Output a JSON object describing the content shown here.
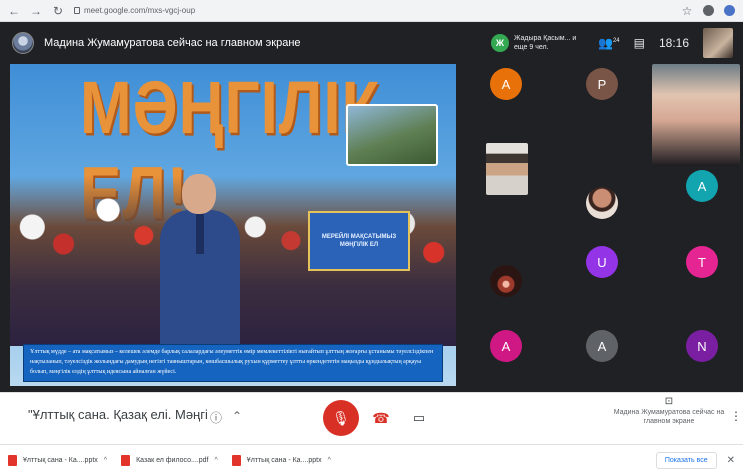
{
  "browser": {
    "url": "meet.google.com/mxs-vgcj-oup",
    "back": "←",
    "forward": "→",
    "reload": "↻",
    "ext_star": "☆"
  },
  "meet": {
    "presenting_title": "Мадина Жумамуратова сейчас на главном экране",
    "participants_badge_letter": "Ж",
    "participants_text": "Жадыра Қасым... и еще 9 чел.",
    "people_count": "24",
    "clock": "18:16",
    "slide": {
      "title": "МӘҢГІЛІК ЕЛ!",
      "sign_text": "МЕРЕЙЛІ МАҚСАТЫМЫЗ МӘҢГІЛІК ЕЛ",
      "caption": "Ұлттық мүдде – ата мақсатымыз – келешек әлемде барлық салалардағы әлеуметтік өмір мемлекеттілікті нығайтып ұлттың жоғарғы ұстанымы тәуелсіздікпен нақтыланып, тәуелсіздік жолындағы дамудың негізгі таяныштарын, көшбасшылық рухын құрметтеу ұлтты өркендететін маңызды құндылықтың арқауы болып, мәңгілік елдің ұлттық идеясына айналған жүйесі."
    },
    "tiles": [
      {
        "letter": "A",
        "color": "#e8710a"
      },
      {
        "letter": "P",
        "color": "#795548"
      },
      {
        "letter": "A",
        "color": "#12a4af"
      },
      {
        "letter": "U",
        "color": "#9334e6"
      },
      {
        "letter": "T",
        "color": "#e52592"
      },
      {
        "letter": "A",
        "color": "#d01884"
      },
      {
        "letter": "A",
        "color": "#5f6368"
      },
      {
        "letter": "N",
        "color": "#7b1fa2"
      }
    ]
  },
  "controls": {
    "meeting_title": "\"Ұлттық сана. Қазақ елі. Мәңгілік ел\" т...",
    "present_label": "Мадина Жумамуратова сейчас на главном экране",
    "mic_icon": "🎙",
    "hangup_icon": "☎",
    "camera_icon": "▭",
    "present_icon": "⊡",
    "more_icon": "⋮"
  },
  "downloads": {
    "items": [
      {
        "name": "Ұлттық сана - Ка....pptx"
      },
      {
        "name": "Казак ел филосо....pdf"
      },
      {
        "name": "Ұлттық сана - Ка....pptx"
      }
    ],
    "show_all": "Показать все",
    "close": "✕"
  }
}
